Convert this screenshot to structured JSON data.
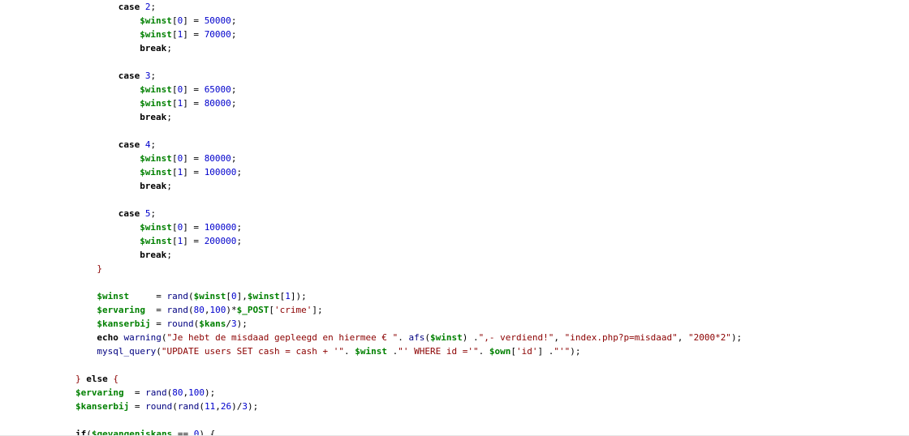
{
  "colors": {
    "background": "#ffffff",
    "keyword": "#000000",
    "variable": "#008000",
    "number": "#0000cc",
    "string": "#8b0000",
    "function": "#000080"
  },
  "code_lines": [
    {
      "indent": 18,
      "tokens": [
        {
          "t": "case",
          "c": "kw"
        },
        {
          "t": " "
        },
        {
          "t": "2",
          "c": "num"
        },
        {
          "t": ";"
        }
      ]
    },
    {
      "indent": 22,
      "tokens": [
        {
          "t": "$winst",
          "c": "var"
        },
        {
          "t": "[",
          "c": "op"
        },
        {
          "t": "0",
          "c": "num"
        },
        {
          "t": "] = "
        },
        {
          "t": "50000",
          "c": "num"
        },
        {
          "t": ";"
        }
      ]
    },
    {
      "indent": 22,
      "tokens": [
        {
          "t": "$winst",
          "c": "var"
        },
        {
          "t": "[",
          "c": "op"
        },
        {
          "t": "1",
          "c": "num"
        },
        {
          "t": "] = "
        },
        {
          "t": "70000",
          "c": "num"
        },
        {
          "t": ";"
        }
      ]
    },
    {
      "indent": 22,
      "tokens": [
        {
          "t": "break",
          "c": "kw"
        },
        {
          "t": ";"
        }
      ]
    },
    {
      "indent": 0,
      "tokens": []
    },
    {
      "indent": 18,
      "tokens": [
        {
          "t": "case",
          "c": "kw"
        },
        {
          "t": " "
        },
        {
          "t": "3",
          "c": "num"
        },
        {
          "t": ";"
        }
      ]
    },
    {
      "indent": 22,
      "tokens": [
        {
          "t": "$winst",
          "c": "var"
        },
        {
          "t": "[",
          "c": "op"
        },
        {
          "t": "0",
          "c": "num"
        },
        {
          "t": "] = "
        },
        {
          "t": "65000",
          "c": "num"
        },
        {
          "t": ";"
        }
      ]
    },
    {
      "indent": 22,
      "tokens": [
        {
          "t": "$winst",
          "c": "var"
        },
        {
          "t": "[",
          "c": "op"
        },
        {
          "t": "1",
          "c": "num"
        },
        {
          "t": "] = "
        },
        {
          "t": "80000",
          "c": "num"
        },
        {
          "t": ";"
        }
      ]
    },
    {
      "indent": 22,
      "tokens": [
        {
          "t": "break",
          "c": "kw"
        },
        {
          "t": ";"
        }
      ]
    },
    {
      "indent": 0,
      "tokens": []
    },
    {
      "indent": 18,
      "tokens": [
        {
          "t": "case",
          "c": "kw"
        },
        {
          "t": " "
        },
        {
          "t": "4",
          "c": "num"
        },
        {
          "t": ";"
        }
      ]
    },
    {
      "indent": 22,
      "tokens": [
        {
          "t": "$winst",
          "c": "var"
        },
        {
          "t": "[",
          "c": "op"
        },
        {
          "t": "0",
          "c": "num"
        },
        {
          "t": "] = "
        },
        {
          "t": "80000",
          "c": "num"
        },
        {
          "t": ";"
        }
      ]
    },
    {
      "indent": 22,
      "tokens": [
        {
          "t": "$winst",
          "c": "var"
        },
        {
          "t": "[",
          "c": "op"
        },
        {
          "t": "1",
          "c": "num"
        },
        {
          "t": "] = "
        },
        {
          "t": "100000",
          "c": "num"
        },
        {
          "t": ";"
        }
      ]
    },
    {
      "indent": 22,
      "tokens": [
        {
          "t": "break",
          "c": "kw"
        },
        {
          "t": ";"
        }
      ]
    },
    {
      "indent": 0,
      "tokens": []
    },
    {
      "indent": 18,
      "tokens": [
        {
          "t": "case",
          "c": "kw"
        },
        {
          "t": " "
        },
        {
          "t": "5",
          "c": "num"
        },
        {
          "t": ";"
        }
      ]
    },
    {
      "indent": 22,
      "tokens": [
        {
          "t": "$winst",
          "c": "var"
        },
        {
          "t": "[",
          "c": "op"
        },
        {
          "t": "0",
          "c": "num"
        },
        {
          "t": "] = "
        },
        {
          "t": "100000",
          "c": "num"
        },
        {
          "t": ";"
        }
      ]
    },
    {
      "indent": 22,
      "tokens": [
        {
          "t": "$winst",
          "c": "var"
        },
        {
          "t": "[",
          "c": "op"
        },
        {
          "t": "1",
          "c": "num"
        },
        {
          "t": "] = "
        },
        {
          "t": "200000",
          "c": "num"
        },
        {
          "t": ";"
        }
      ]
    },
    {
      "indent": 22,
      "tokens": [
        {
          "t": "break",
          "c": "kw"
        },
        {
          "t": ";"
        }
      ]
    },
    {
      "indent": 14,
      "tokens": [
        {
          "t": "}",
          "c": "str"
        }
      ]
    },
    {
      "indent": 0,
      "tokens": []
    },
    {
      "indent": 14,
      "tokens": [
        {
          "t": "$winst",
          "c": "var"
        },
        {
          "t": "     = "
        },
        {
          "t": "rand",
          "c": "fn"
        },
        {
          "t": "("
        },
        {
          "t": "$winst",
          "c": "var"
        },
        {
          "t": "["
        },
        {
          "t": "0",
          "c": "num"
        },
        {
          "t": "],"
        },
        {
          "t": "$winst",
          "c": "var"
        },
        {
          "t": "["
        },
        {
          "t": "1",
          "c": "num"
        },
        {
          "t": "]);"
        }
      ]
    },
    {
      "indent": 14,
      "tokens": [
        {
          "t": "$ervaring",
          "c": "var"
        },
        {
          "t": "  = "
        },
        {
          "t": "rand",
          "c": "fn"
        },
        {
          "t": "("
        },
        {
          "t": "80",
          "c": "num"
        },
        {
          "t": ","
        },
        {
          "t": "100",
          "c": "num"
        },
        {
          "t": ")*"
        },
        {
          "t": "$_POST",
          "c": "var"
        },
        {
          "t": "["
        },
        {
          "t": "'crime'",
          "c": "str"
        },
        {
          "t": "];"
        }
      ]
    },
    {
      "indent": 14,
      "tokens": [
        {
          "t": "$kanserbij",
          "c": "var"
        },
        {
          "t": " = "
        },
        {
          "t": "round",
          "c": "fn"
        },
        {
          "t": "("
        },
        {
          "t": "$kans",
          "c": "var"
        },
        {
          "t": "/"
        },
        {
          "t": "3",
          "c": "num"
        },
        {
          "t": ");"
        }
      ]
    },
    {
      "indent": 14,
      "tokens": [
        {
          "t": "echo",
          "c": "kw"
        },
        {
          "t": " "
        },
        {
          "t": "warning",
          "c": "fn"
        },
        {
          "t": "("
        },
        {
          "t": "\"Je hebt de misdaad gepleegd en hiermee € \"",
          "c": "str"
        },
        {
          "t": ". "
        },
        {
          "t": "afs",
          "c": "fn"
        },
        {
          "t": "("
        },
        {
          "t": "$winst",
          "c": "var"
        },
        {
          "t": ") ."
        },
        {
          "t": "\",- verdiend!\"",
          "c": "str"
        },
        {
          "t": ", "
        },
        {
          "t": "\"index.php?p=misdaad\"",
          "c": "str"
        },
        {
          "t": ", "
        },
        {
          "t": "\"2000*2\"",
          "c": "str"
        },
        {
          "t": ");"
        }
      ]
    },
    {
      "indent": 14,
      "tokens": [
        {
          "t": "mysql_query",
          "c": "fn"
        },
        {
          "t": "("
        },
        {
          "t": "\"UPDATE users SET cash = cash + '\"",
          "c": "str"
        },
        {
          "t": ". "
        },
        {
          "t": "$winst",
          "c": "var"
        },
        {
          "t": " ."
        },
        {
          "t": "\"' WHERE id ='\"",
          "c": "str"
        },
        {
          "t": ". "
        },
        {
          "t": "$own",
          "c": "var"
        },
        {
          "t": "["
        },
        {
          "t": "'id'",
          "c": "str"
        },
        {
          "t": "] ."
        },
        {
          "t": "\"'\"",
          "c": "str"
        },
        {
          "t": ");"
        }
      ]
    },
    {
      "indent": 0,
      "tokens": []
    },
    {
      "indent": 10,
      "tokens": [
        {
          "t": "} ",
          "c": "str"
        },
        {
          "t": "else",
          "c": "kw"
        },
        {
          "t": " {",
          "c": "str"
        }
      ]
    },
    {
      "indent": 10,
      "tokens": [
        {
          "t": "$ervaring",
          "c": "var"
        },
        {
          "t": "  = "
        },
        {
          "t": "rand",
          "c": "fn"
        },
        {
          "t": "("
        },
        {
          "t": "80",
          "c": "num"
        },
        {
          "t": ","
        },
        {
          "t": "100",
          "c": "num"
        },
        {
          "t": ");"
        }
      ]
    },
    {
      "indent": 10,
      "tokens": [
        {
          "t": "$kanserbij",
          "c": "var"
        },
        {
          "t": " = "
        },
        {
          "t": "round",
          "c": "fn"
        },
        {
          "t": "("
        },
        {
          "t": "rand",
          "c": "fn"
        },
        {
          "t": "("
        },
        {
          "t": "11",
          "c": "num"
        },
        {
          "t": ","
        },
        {
          "t": "26",
          "c": "num"
        },
        {
          "t": ")/"
        },
        {
          "t": "3",
          "c": "num"
        },
        {
          "t": ");"
        }
      ]
    },
    {
      "indent": 0,
      "tokens": []
    },
    {
      "indent": 10,
      "tokens": [
        {
          "t": "if",
          "c": "kw"
        },
        {
          "t": "("
        },
        {
          "t": "$gevangeniskans",
          "c": "var"
        },
        {
          "t": " == "
        },
        {
          "t": "0",
          "c": "num"
        },
        {
          "t": ") {"
        }
      ]
    }
  ]
}
